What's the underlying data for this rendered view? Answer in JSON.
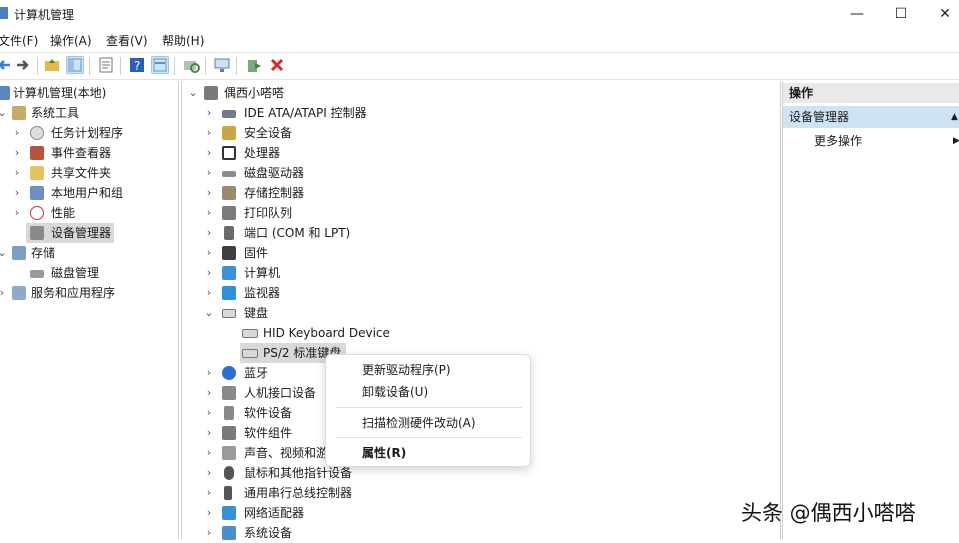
{
  "window": {
    "title": "计算机管理",
    "minimize": "—",
    "maximize": "☐",
    "close": "✕"
  },
  "menu": [
    "文件(F)",
    "操作(A)",
    "查看(V)",
    "帮助(H)"
  ],
  "toolbar_icons": [
    "back-arrow-icon",
    "forward-arrow-icon",
    "up-folder-icon",
    "show-tree-icon",
    "properties-icon",
    "help-icon",
    "view-icon",
    "scan-icon",
    "monitor-icon",
    "update-driver-icon",
    "uninstall-icon"
  ],
  "left_tree": {
    "root": "计算机管理(本地)",
    "items": [
      {
        "label": "系统工具",
        "level": 1
      },
      {
        "label": "任务计划程序",
        "level": 2
      },
      {
        "label": "事件查看器",
        "level": 2
      },
      {
        "label": "共享文件夹",
        "level": 2
      },
      {
        "label": "本地用户和组",
        "level": 2
      },
      {
        "label": "性能",
        "level": 2
      },
      {
        "label": "设备管理器",
        "level": 2,
        "selected": true
      },
      {
        "label": "存储",
        "level": 1
      },
      {
        "label": "磁盘管理",
        "level": 2
      },
      {
        "label": "服务和应用程序",
        "level": 1
      }
    ]
  },
  "device_tree": {
    "root": "偶西小嗒嗒",
    "categories": [
      "IDE ATA/ATAPI 控制器",
      "安全设备",
      "处理器",
      "磁盘驱动器",
      "存储控制器",
      "打印队列",
      "端口 (COM 和 LPT)",
      "固件",
      "计算机",
      "监视器",
      "键盘"
    ],
    "keyboard_children": [
      "HID Keyboard Device",
      "PS/2 标准键盘"
    ],
    "after": [
      "蓝牙",
      "人机接口设备",
      "软件设备",
      "软件组件",
      "声音、视频和游",
      "鼠标和其他指针设备",
      "通用串行总线控制器",
      "网络适配器",
      "系统设备"
    ]
  },
  "actions": {
    "header": "操作",
    "section": "设备管理器",
    "more": "更多操作"
  },
  "context_menu": {
    "update": "更新驱动程序(P)",
    "uninstall": "卸载设备(U)",
    "scan": "扫描检测硬件改动(A)",
    "properties": "属性(R)"
  },
  "watermark": "头条 @偶西小嗒嗒"
}
